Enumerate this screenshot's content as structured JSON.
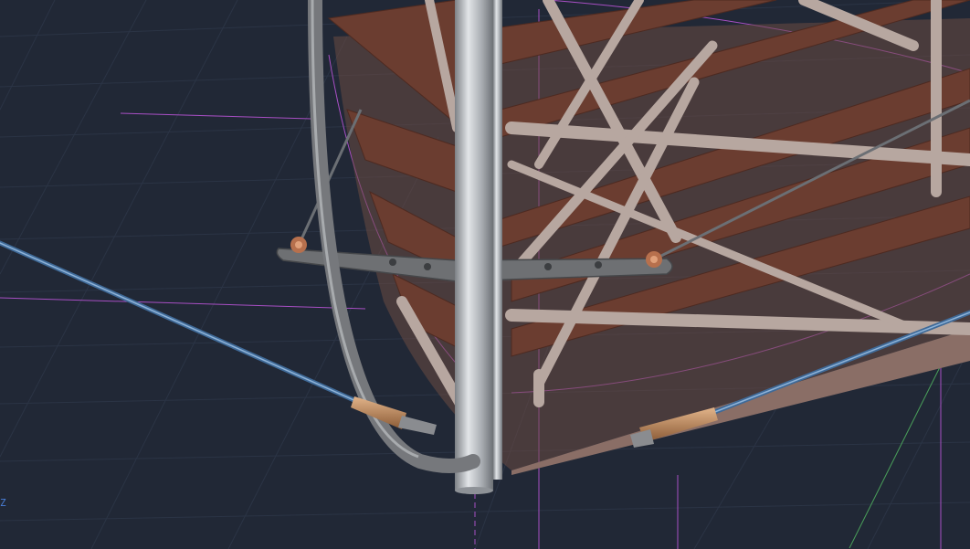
{
  "viewport": {
    "background_color": "#212836",
    "grid_color": "#2b3445",
    "axis_indicator_label": "Z"
  },
  "model": {
    "tube_color": "#b7a7a0",
    "rib_color": "#6b3d30",
    "post_color": "#c4c8cc",
    "cable_color": "#5a82b0",
    "fitting_color": "#c08a5c",
    "plate_color": "#6e7073",
    "guide_line_color": "#b05ad0"
  }
}
